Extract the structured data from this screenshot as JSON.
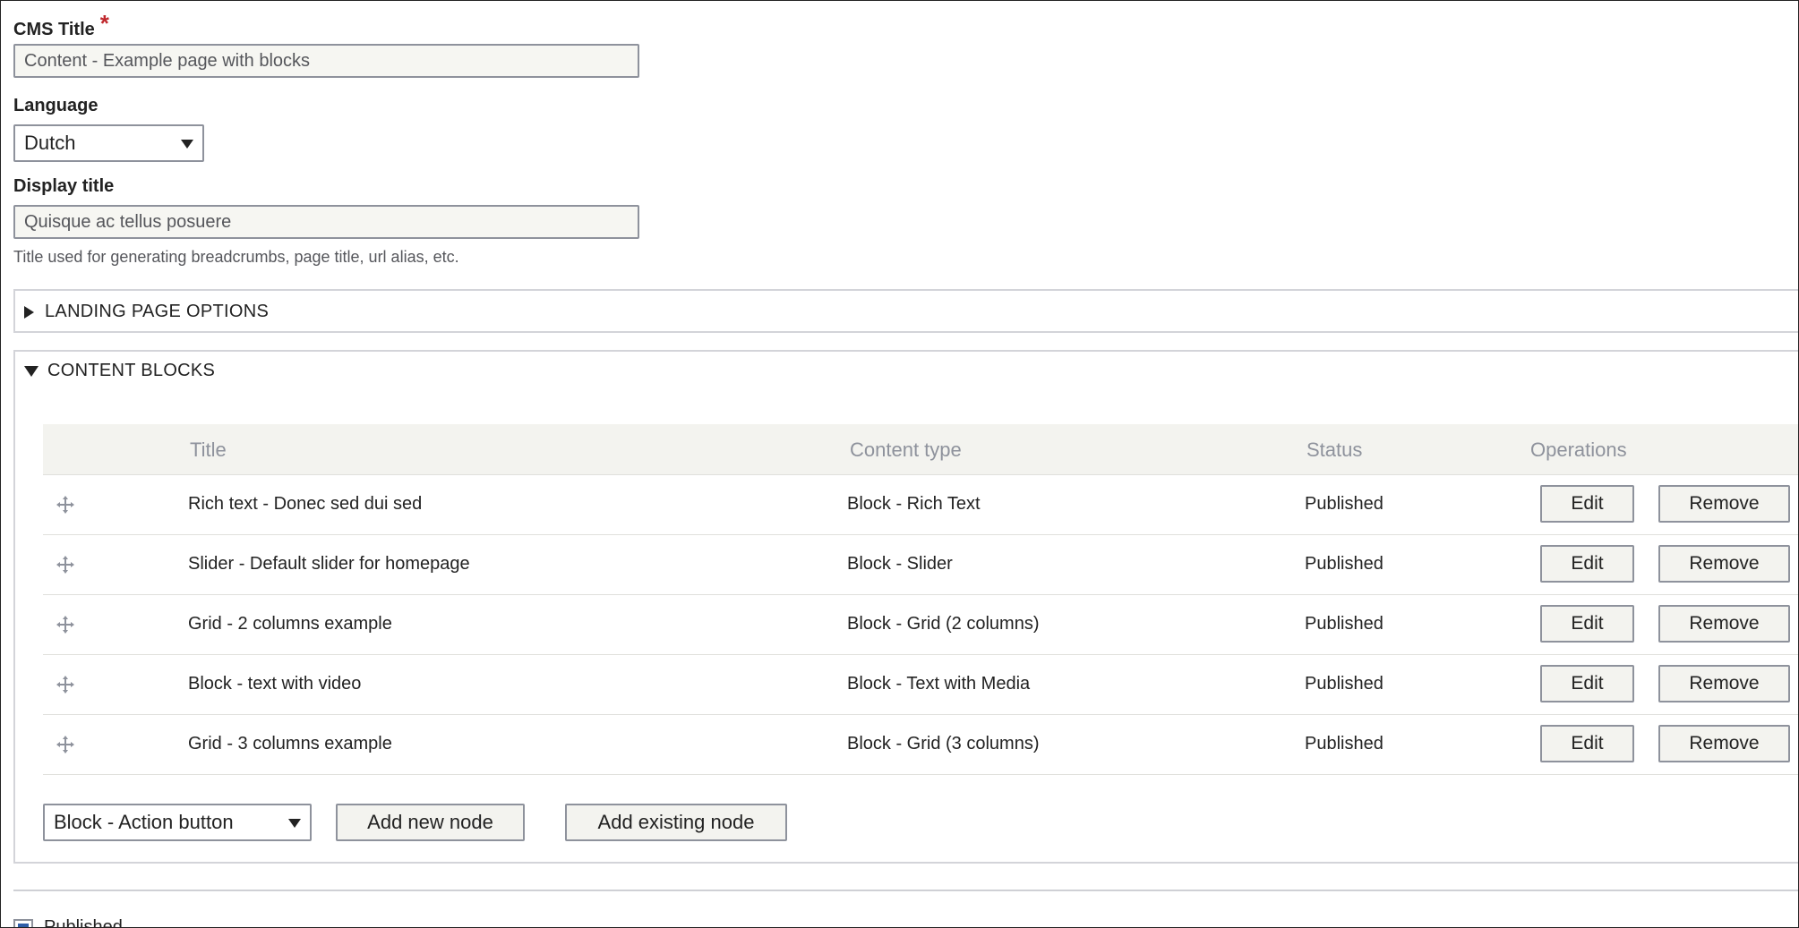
{
  "cms_title": {
    "label": "CMS Title",
    "required_mark": "*",
    "value": "Content - Example page with blocks"
  },
  "language": {
    "label": "Language",
    "selected": "Dutch"
  },
  "display_title": {
    "label": "Display title",
    "value": "Quisque ac tellus posuere",
    "help": "Title used for generating breadcrumbs, page title, url alias, etc."
  },
  "landing_page_options": {
    "summary": "LANDING PAGE OPTIONS",
    "expanded": false
  },
  "content_blocks": {
    "summary": "CONTENT BLOCKS",
    "expanded": true,
    "columns": {
      "title": "Title",
      "content_type": "Content type",
      "status": "Status",
      "operations": "Operations"
    },
    "rows": [
      {
        "title": "Rich text - Donec sed dui sed",
        "content_type": "Block - Rich Text",
        "status": "Published",
        "edit": "Edit",
        "remove": "Remove"
      },
      {
        "title": "Slider - Default slider for homepage",
        "content_type": "Block - Slider",
        "status": "Published",
        "edit": "Edit",
        "remove": "Remove"
      },
      {
        "title": "Grid - 2 columns example",
        "content_type": "Block - Grid (2 columns)",
        "status": "Published",
        "edit": "Edit",
        "remove": "Remove"
      },
      {
        "title": "Block - text with video",
        "content_type": "Block - Text with Media",
        "status": "Published",
        "edit": "Edit",
        "remove": "Remove"
      },
      {
        "title": "Grid - 3 columns example",
        "content_type": "Block - Grid (3 columns)",
        "status": "Published",
        "edit": "Edit",
        "remove": "Remove"
      }
    ],
    "block_type_select": "Block - Action button",
    "add_new_label": "Add new node",
    "add_existing_label": "Add existing node"
  },
  "published": {
    "label": "Published",
    "checked": true
  },
  "colors": {
    "required": "#c0282d",
    "checkbox_accent": "#2f5ea8",
    "table_header_bg": "#f3f3ef"
  }
}
